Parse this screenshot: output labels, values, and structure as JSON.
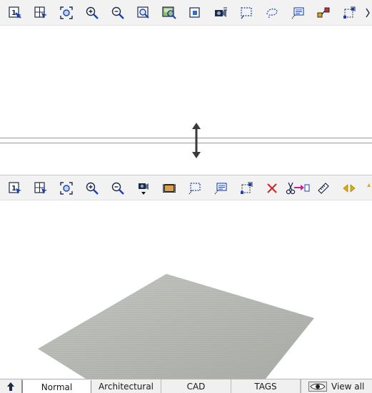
{
  "top_toolbar": {
    "icons": [
      "zoom-1to1-icon",
      "zoom-extents-icon",
      "zoom-window-icon",
      "zoom-in-icon",
      "zoom-out-icon",
      "zoom-search-icon",
      "zoom-image-icon",
      "zoom-frame-icon",
      "camera-view-icon",
      "select-rectangle-icon",
      "select-lasso-icon",
      "annotation-icon",
      "node-link-icon",
      "transform-icon",
      "nudge-icon"
    ]
  },
  "bottom_toolbar": {
    "icons": [
      "zoom-1to1-icon",
      "zoom-extents-icon",
      "zoom-window-icon",
      "zoom-in-icon",
      "zoom-out-icon",
      "camera-dropdown-icon",
      "filmstrip-icon",
      "select-rectangle-icon",
      "annotation-icon",
      "transform-icon",
      "delete-icon",
      "cut-move-icon",
      "measure-icon",
      "arrow-left-right-icon",
      "star-icon"
    ]
  },
  "tabs": [
    {
      "label": "Normal",
      "active": true
    },
    {
      "label": "Architectural",
      "active": false
    },
    {
      "label": "CAD",
      "active": false
    },
    {
      "label": "TAGS",
      "active": false
    }
  ],
  "view_all": {
    "label": "View all"
  },
  "colors": {
    "toolbar_bg": "#f2f2f2",
    "icon_blue": "#1a3fb0",
    "icon_dark": "#1c2a48",
    "plane_fill": "#b6b9b3",
    "delete_red": "#d02020",
    "arrow_yellow": "#e0b000"
  }
}
